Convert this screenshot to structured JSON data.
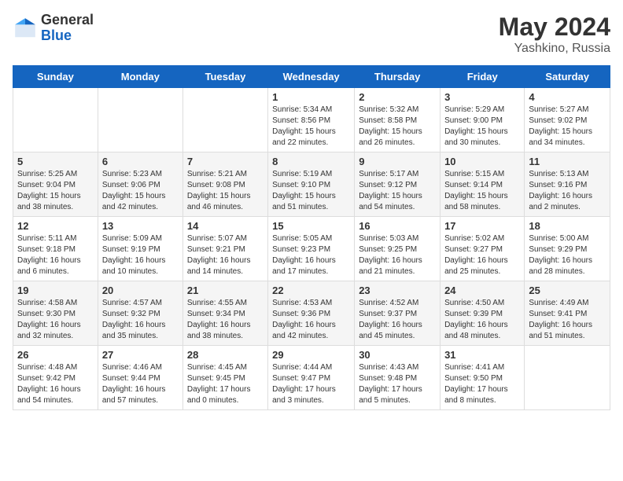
{
  "header": {
    "logo_general": "General",
    "logo_blue": "Blue",
    "month_title": "May 2024",
    "location": "Yashkino, Russia"
  },
  "days_of_week": [
    "Sunday",
    "Monday",
    "Tuesday",
    "Wednesday",
    "Thursday",
    "Friday",
    "Saturday"
  ],
  "weeks": [
    [
      {
        "day": "",
        "info": ""
      },
      {
        "day": "",
        "info": ""
      },
      {
        "day": "",
        "info": ""
      },
      {
        "day": "1",
        "info": "Sunrise: 5:34 AM\nSunset: 8:56 PM\nDaylight: 15 hours\nand 22 minutes."
      },
      {
        "day": "2",
        "info": "Sunrise: 5:32 AM\nSunset: 8:58 PM\nDaylight: 15 hours\nand 26 minutes."
      },
      {
        "day": "3",
        "info": "Sunrise: 5:29 AM\nSunset: 9:00 PM\nDaylight: 15 hours\nand 30 minutes."
      },
      {
        "day": "4",
        "info": "Sunrise: 5:27 AM\nSunset: 9:02 PM\nDaylight: 15 hours\nand 34 minutes."
      }
    ],
    [
      {
        "day": "5",
        "info": "Sunrise: 5:25 AM\nSunset: 9:04 PM\nDaylight: 15 hours\nand 38 minutes."
      },
      {
        "day": "6",
        "info": "Sunrise: 5:23 AM\nSunset: 9:06 PM\nDaylight: 15 hours\nand 42 minutes."
      },
      {
        "day": "7",
        "info": "Sunrise: 5:21 AM\nSunset: 9:08 PM\nDaylight: 15 hours\nand 46 minutes."
      },
      {
        "day": "8",
        "info": "Sunrise: 5:19 AM\nSunset: 9:10 PM\nDaylight: 15 hours\nand 51 minutes."
      },
      {
        "day": "9",
        "info": "Sunrise: 5:17 AM\nSunset: 9:12 PM\nDaylight: 15 hours\nand 54 minutes."
      },
      {
        "day": "10",
        "info": "Sunrise: 5:15 AM\nSunset: 9:14 PM\nDaylight: 15 hours\nand 58 minutes."
      },
      {
        "day": "11",
        "info": "Sunrise: 5:13 AM\nSunset: 9:16 PM\nDaylight: 16 hours\nand 2 minutes."
      }
    ],
    [
      {
        "day": "12",
        "info": "Sunrise: 5:11 AM\nSunset: 9:18 PM\nDaylight: 16 hours\nand 6 minutes."
      },
      {
        "day": "13",
        "info": "Sunrise: 5:09 AM\nSunset: 9:19 PM\nDaylight: 16 hours\nand 10 minutes."
      },
      {
        "day": "14",
        "info": "Sunrise: 5:07 AM\nSunset: 9:21 PM\nDaylight: 16 hours\nand 14 minutes."
      },
      {
        "day": "15",
        "info": "Sunrise: 5:05 AM\nSunset: 9:23 PM\nDaylight: 16 hours\nand 17 minutes."
      },
      {
        "day": "16",
        "info": "Sunrise: 5:03 AM\nSunset: 9:25 PM\nDaylight: 16 hours\nand 21 minutes."
      },
      {
        "day": "17",
        "info": "Sunrise: 5:02 AM\nSunset: 9:27 PM\nDaylight: 16 hours\nand 25 minutes."
      },
      {
        "day": "18",
        "info": "Sunrise: 5:00 AM\nSunset: 9:29 PM\nDaylight: 16 hours\nand 28 minutes."
      }
    ],
    [
      {
        "day": "19",
        "info": "Sunrise: 4:58 AM\nSunset: 9:30 PM\nDaylight: 16 hours\nand 32 minutes."
      },
      {
        "day": "20",
        "info": "Sunrise: 4:57 AM\nSunset: 9:32 PM\nDaylight: 16 hours\nand 35 minutes."
      },
      {
        "day": "21",
        "info": "Sunrise: 4:55 AM\nSunset: 9:34 PM\nDaylight: 16 hours\nand 38 minutes."
      },
      {
        "day": "22",
        "info": "Sunrise: 4:53 AM\nSunset: 9:36 PM\nDaylight: 16 hours\nand 42 minutes."
      },
      {
        "day": "23",
        "info": "Sunrise: 4:52 AM\nSunset: 9:37 PM\nDaylight: 16 hours\nand 45 minutes."
      },
      {
        "day": "24",
        "info": "Sunrise: 4:50 AM\nSunset: 9:39 PM\nDaylight: 16 hours\nand 48 minutes."
      },
      {
        "day": "25",
        "info": "Sunrise: 4:49 AM\nSunset: 9:41 PM\nDaylight: 16 hours\nand 51 minutes."
      }
    ],
    [
      {
        "day": "26",
        "info": "Sunrise: 4:48 AM\nSunset: 9:42 PM\nDaylight: 16 hours\nand 54 minutes."
      },
      {
        "day": "27",
        "info": "Sunrise: 4:46 AM\nSunset: 9:44 PM\nDaylight: 16 hours\nand 57 minutes."
      },
      {
        "day": "28",
        "info": "Sunrise: 4:45 AM\nSunset: 9:45 PM\nDaylight: 17 hours\nand 0 minutes."
      },
      {
        "day": "29",
        "info": "Sunrise: 4:44 AM\nSunset: 9:47 PM\nDaylight: 17 hours\nand 3 minutes."
      },
      {
        "day": "30",
        "info": "Sunrise: 4:43 AM\nSunset: 9:48 PM\nDaylight: 17 hours\nand 5 minutes."
      },
      {
        "day": "31",
        "info": "Sunrise: 4:41 AM\nSunset: 9:50 PM\nDaylight: 17 hours\nand 8 minutes."
      },
      {
        "day": "",
        "info": ""
      }
    ]
  ]
}
